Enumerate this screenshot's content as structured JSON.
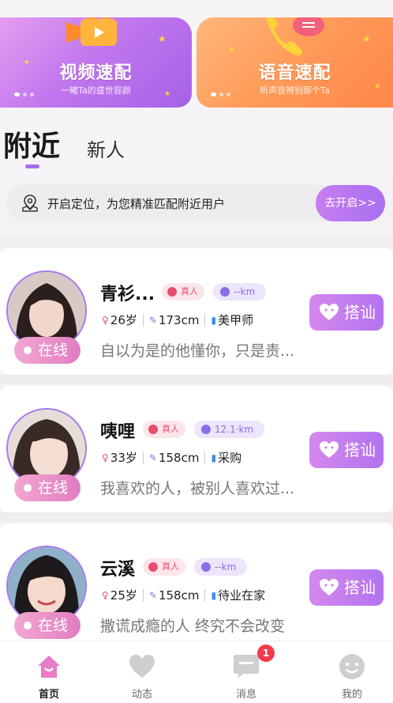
{
  "banners": [
    {
      "title": "视频速配",
      "subtitle": "一睹Ta的盛世容颜"
    },
    {
      "title": "语音速配",
      "subtitle": "听声音辨别那个Ta"
    }
  ],
  "tabs": {
    "nearby": "附近",
    "new": "新人"
  },
  "location": {
    "text": "开启定位，为您精准匹配附近用户",
    "button": "去开启>>"
  },
  "users": [
    {
      "name": "青衫...",
      "real": "真人",
      "distance": "--km",
      "age": "26岁",
      "height": "173cm",
      "job": "美甲师",
      "signature": "自以为是的他懂你，只是责...",
      "status": "在线",
      "chat": "搭讪"
    },
    {
      "name": "咦哩",
      "real": "真人",
      "distance": "12.1·km",
      "age": "33岁",
      "height": "158cm",
      "job": "采购",
      "signature": "我喜欢的人，被别人喜欢过...",
      "status": "在线",
      "chat": "搭讪"
    },
    {
      "name": "云溪",
      "real": "真人",
      "distance": "--km",
      "age": "25岁",
      "height": "158cm",
      "job": "待业在家",
      "signature": "撒谎成瘾的人 终究不会改变",
      "status": "在线",
      "chat": "搭讪"
    }
  ],
  "nav": {
    "home": "首页",
    "moments": "动态",
    "messages": "消息",
    "messages_badge": "1",
    "mine": "我的"
  },
  "colors": {
    "accent": "#a46cf0",
    "online": "#e07dc0",
    "badge_red": "#f03c4a"
  }
}
